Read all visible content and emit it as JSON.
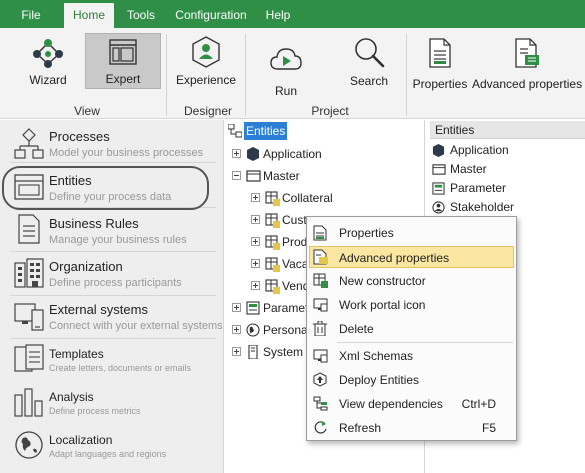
{
  "colors": {
    "accent": "#2f8f46",
    "selection": "#2d7fd6",
    "menu_hover": "#fbe7a1"
  },
  "menu": {
    "file": "File",
    "home": "Home",
    "tools": "Tools",
    "configuration": "Configuration",
    "help": "Help"
  },
  "ribbon": {
    "view": {
      "wizard": "Wizard",
      "expert": "Expert",
      "group": "View"
    },
    "designer": {
      "experience": "Experience",
      "group": "Designer"
    },
    "project": {
      "run": "Run",
      "search": "Search",
      "group": "Project"
    },
    "properties": "Properties",
    "advanced_properties": "Advanced properties"
  },
  "nav": [
    {
      "title": "Processes",
      "subtitle": "Model your business processes",
      "icon": "processes-icon"
    },
    {
      "title": "Entities",
      "subtitle": "Define your process data",
      "icon": "entities-icon"
    },
    {
      "title": "Business Rules",
      "subtitle": "Manage your business rules",
      "icon": "business-rules-icon"
    },
    {
      "title": "Organization",
      "subtitle": "Define process participants",
      "icon": "organization-icon"
    },
    {
      "title": "External systems",
      "subtitle": "Connect with your external systems",
      "icon": "external-systems-icon"
    },
    {
      "title": "Templates",
      "subtitle": "Create letters, documents or emails",
      "icon": "templates-icon"
    },
    {
      "title": "Analysis",
      "subtitle": "Define process metrics",
      "icon": "analysis-icon"
    },
    {
      "title": "Localization",
      "subtitle": "Adapt languages and regions",
      "icon": "localization-icon"
    }
  ],
  "tree": {
    "root": "Entities",
    "application": "Application",
    "master": "Master",
    "children": [
      "Collateral",
      "Customers",
      "Prod",
      "Vaca",
      "Vend"
    ],
    "parameter": "Paramet",
    "personal": "Persona",
    "system": "System"
  },
  "list": {
    "header": "Entities",
    "items": [
      "Application",
      "Master",
      "Parameter",
      "Stakeholder"
    ]
  },
  "context_menu": {
    "properties": "Properties",
    "advanced_properties": "Advanced properties",
    "new_constructor": "New constructor",
    "work_portal_icon": "Work portal icon",
    "delete": "Delete",
    "xml_schemas": "Xml Schemas",
    "deploy_entities": "Deploy Entities",
    "view_dependencies": "View dependencies",
    "view_dependencies_shortcut": "Ctrl+D",
    "refresh": "Refresh",
    "refresh_shortcut": "F5"
  }
}
